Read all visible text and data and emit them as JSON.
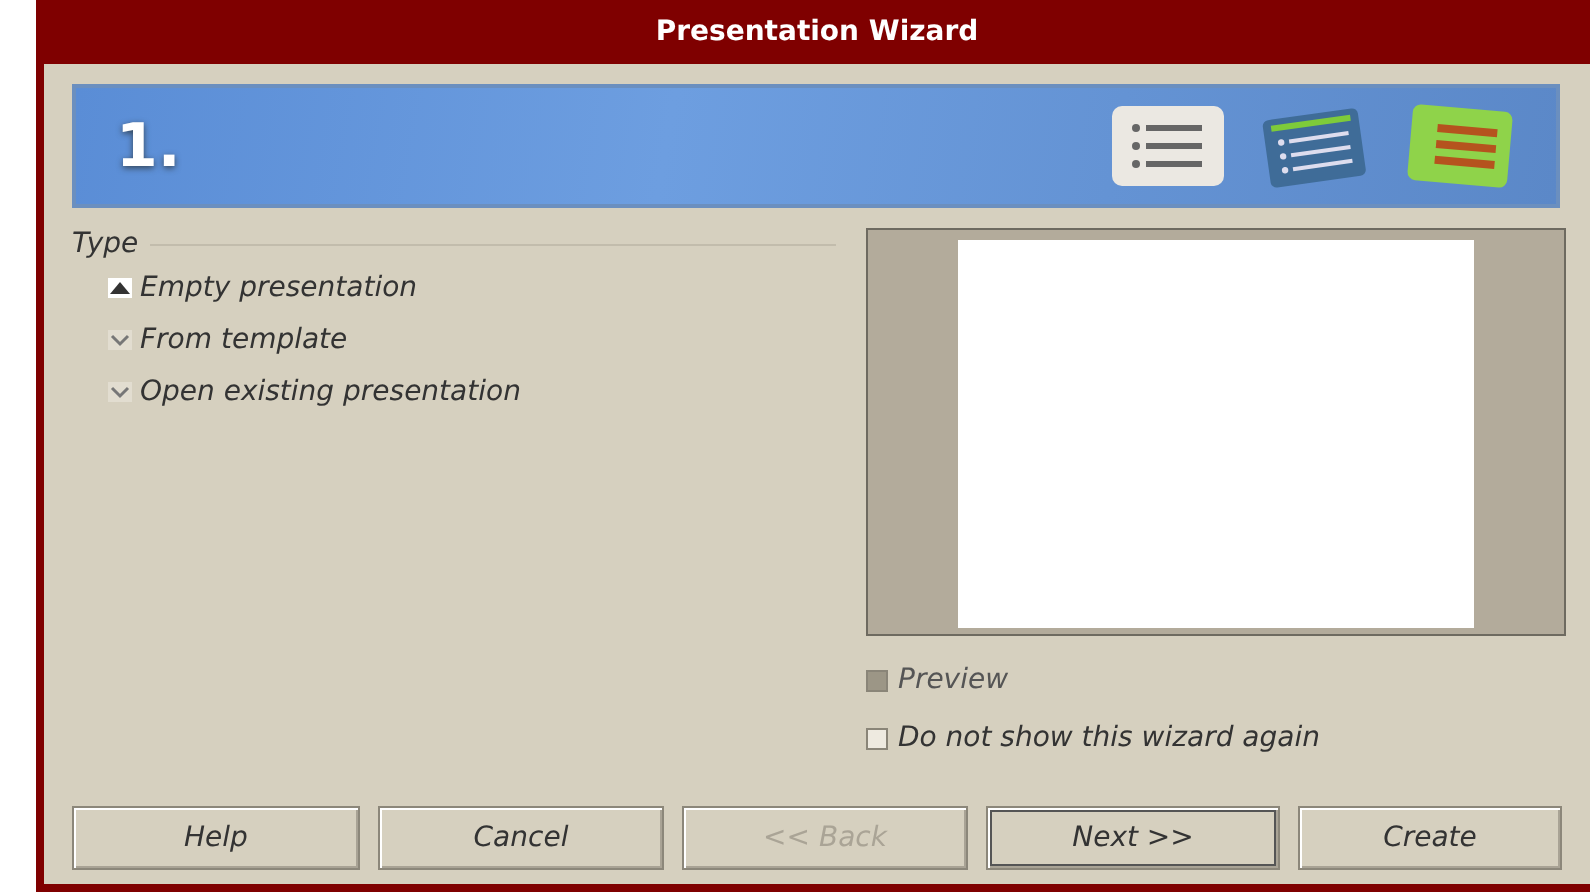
{
  "window": {
    "title": "Presentation Wizard"
  },
  "banner": {
    "step": "1."
  },
  "type_group": {
    "label": "Type",
    "options": [
      {
        "label": "Empty presentation",
        "selected": true
      },
      {
        "label": "From template",
        "selected": false
      },
      {
        "label": "Open existing presentation",
        "selected": false
      }
    ]
  },
  "preview_checkbox": {
    "label": "Preview",
    "checked": false,
    "disabled": true
  },
  "dont_show_checkbox": {
    "label": "Do not show this wizard again",
    "checked": false,
    "disabled": false
  },
  "buttons": [
    {
      "label": "Help",
      "disabled": false,
      "focused": false
    },
    {
      "label": "Cancel",
      "disabled": false,
      "focused": false
    },
    {
      "label": "<< Back",
      "disabled": true,
      "focused": false
    },
    {
      "label": "Next >>",
      "disabled": false,
      "focused": true
    },
    {
      "label": "Create",
      "disabled": false,
      "focused": false
    }
  ]
}
